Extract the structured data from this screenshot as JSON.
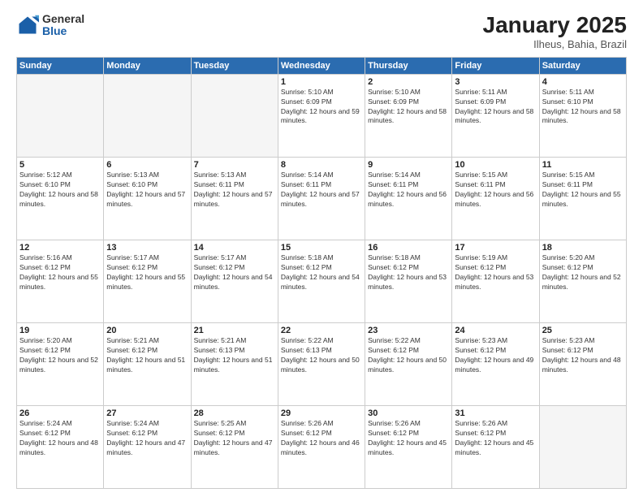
{
  "logo": {
    "general": "General",
    "blue": "Blue"
  },
  "header": {
    "month": "January 2025",
    "location": "Ilheus, Bahia, Brazil"
  },
  "weekdays": [
    "Sunday",
    "Monday",
    "Tuesday",
    "Wednesday",
    "Thursday",
    "Friday",
    "Saturday"
  ],
  "weeks": [
    [
      {
        "day": "",
        "empty": true
      },
      {
        "day": "",
        "empty": true
      },
      {
        "day": "",
        "empty": true
      },
      {
        "day": "1",
        "sunrise": "5:10 AM",
        "sunset": "6:09 PM",
        "daylight": "12 hours and 59 minutes."
      },
      {
        "day": "2",
        "sunrise": "5:10 AM",
        "sunset": "6:09 PM",
        "daylight": "12 hours and 58 minutes."
      },
      {
        "day": "3",
        "sunrise": "5:11 AM",
        "sunset": "6:09 PM",
        "daylight": "12 hours and 58 minutes."
      },
      {
        "day": "4",
        "sunrise": "5:11 AM",
        "sunset": "6:10 PM",
        "daylight": "12 hours and 58 minutes."
      }
    ],
    [
      {
        "day": "5",
        "sunrise": "5:12 AM",
        "sunset": "6:10 PM",
        "daylight": "12 hours and 58 minutes."
      },
      {
        "day": "6",
        "sunrise": "5:13 AM",
        "sunset": "6:10 PM",
        "daylight": "12 hours and 57 minutes."
      },
      {
        "day": "7",
        "sunrise": "5:13 AM",
        "sunset": "6:11 PM",
        "daylight": "12 hours and 57 minutes."
      },
      {
        "day": "8",
        "sunrise": "5:14 AM",
        "sunset": "6:11 PM",
        "daylight": "12 hours and 57 minutes."
      },
      {
        "day": "9",
        "sunrise": "5:14 AM",
        "sunset": "6:11 PM",
        "daylight": "12 hours and 56 minutes."
      },
      {
        "day": "10",
        "sunrise": "5:15 AM",
        "sunset": "6:11 PM",
        "daylight": "12 hours and 56 minutes."
      },
      {
        "day": "11",
        "sunrise": "5:15 AM",
        "sunset": "6:11 PM",
        "daylight": "12 hours and 55 minutes."
      }
    ],
    [
      {
        "day": "12",
        "sunrise": "5:16 AM",
        "sunset": "6:12 PM",
        "daylight": "12 hours and 55 minutes."
      },
      {
        "day": "13",
        "sunrise": "5:17 AM",
        "sunset": "6:12 PM",
        "daylight": "12 hours and 55 minutes."
      },
      {
        "day": "14",
        "sunrise": "5:17 AM",
        "sunset": "6:12 PM",
        "daylight": "12 hours and 54 minutes."
      },
      {
        "day": "15",
        "sunrise": "5:18 AM",
        "sunset": "6:12 PM",
        "daylight": "12 hours and 54 minutes."
      },
      {
        "day": "16",
        "sunrise": "5:18 AM",
        "sunset": "6:12 PM",
        "daylight": "12 hours and 53 minutes."
      },
      {
        "day": "17",
        "sunrise": "5:19 AM",
        "sunset": "6:12 PM",
        "daylight": "12 hours and 53 minutes."
      },
      {
        "day": "18",
        "sunrise": "5:20 AM",
        "sunset": "6:12 PM",
        "daylight": "12 hours and 52 minutes."
      }
    ],
    [
      {
        "day": "19",
        "sunrise": "5:20 AM",
        "sunset": "6:12 PM",
        "daylight": "12 hours and 52 minutes."
      },
      {
        "day": "20",
        "sunrise": "5:21 AM",
        "sunset": "6:12 PM",
        "daylight": "12 hours and 51 minutes."
      },
      {
        "day": "21",
        "sunrise": "5:21 AM",
        "sunset": "6:13 PM",
        "daylight": "12 hours and 51 minutes."
      },
      {
        "day": "22",
        "sunrise": "5:22 AM",
        "sunset": "6:13 PM",
        "daylight": "12 hours and 50 minutes."
      },
      {
        "day": "23",
        "sunrise": "5:22 AM",
        "sunset": "6:12 PM",
        "daylight": "12 hours and 50 minutes."
      },
      {
        "day": "24",
        "sunrise": "5:23 AM",
        "sunset": "6:12 PM",
        "daylight": "12 hours and 49 minutes."
      },
      {
        "day": "25",
        "sunrise": "5:23 AM",
        "sunset": "6:12 PM",
        "daylight": "12 hours and 48 minutes."
      }
    ],
    [
      {
        "day": "26",
        "sunrise": "5:24 AM",
        "sunset": "6:12 PM",
        "daylight": "12 hours and 48 minutes."
      },
      {
        "day": "27",
        "sunrise": "5:24 AM",
        "sunset": "6:12 PM",
        "daylight": "12 hours and 47 minutes."
      },
      {
        "day": "28",
        "sunrise": "5:25 AM",
        "sunset": "6:12 PM",
        "daylight": "12 hours and 47 minutes."
      },
      {
        "day": "29",
        "sunrise": "5:26 AM",
        "sunset": "6:12 PM",
        "daylight": "12 hours and 46 minutes."
      },
      {
        "day": "30",
        "sunrise": "5:26 AM",
        "sunset": "6:12 PM",
        "daylight": "12 hours and 45 minutes."
      },
      {
        "day": "31",
        "sunrise": "5:26 AM",
        "sunset": "6:12 PM",
        "daylight": "12 hours and 45 minutes."
      },
      {
        "day": "",
        "empty": true
      }
    ]
  ],
  "labels": {
    "sunrise": "Sunrise:",
    "sunset": "Sunset:",
    "daylight": "Daylight:"
  }
}
